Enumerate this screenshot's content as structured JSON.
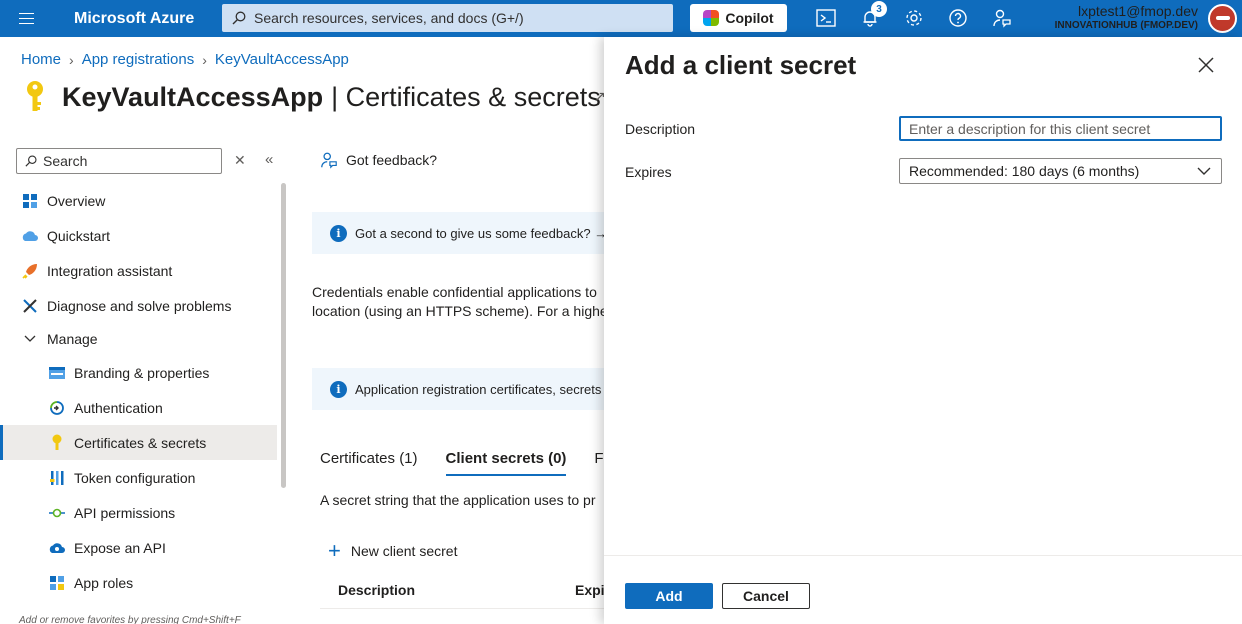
{
  "topbar": {
    "brand": "Microsoft Azure",
    "search_placeholder": "Search resources, services, and docs (G+/)",
    "copilot_label": "Copilot",
    "notification_count": "3",
    "account_email": "lxptest1@fmop.dev",
    "account_tenant": "INNOVATIONHUB (FMOP.DEV)",
    "icons": [
      "hamburger-icon",
      "search-icon",
      "cloud-shell-icon",
      "notifications-icon",
      "settings-icon",
      "help-icon",
      "feedback-icon"
    ]
  },
  "breadcrumb": {
    "items": [
      "Home",
      "App registrations",
      "KeyVaultAccessApp"
    ]
  },
  "page": {
    "app_name": "KeyVaultAccessApp",
    "section_title": "| Certificates & secrets"
  },
  "nav": {
    "search_placeholder": "Search",
    "items": [
      {
        "label": "Overview",
        "icon": "overview-icon"
      },
      {
        "label": "Quickstart",
        "icon": "quickstart-icon"
      },
      {
        "label": "Integration assistant",
        "icon": "rocket-icon"
      },
      {
        "label": "Diagnose and solve problems",
        "icon": "wrench-icon"
      },
      {
        "label": "Manage",
        "icon": "chevron-down-icon"
      },
      {
        "label": "Branding & properties",
        "icon": "branding-icon"
      },
      {
        "label": "Authentication",
        "icon": "authentication-icon"
      },
      {
        "label": "Certificates & secrets",
        "icon": "key-icon",
        "selected": true
      },
      {
        "label": "Token configuration",
        "icon": "token-icon"
      },
      {
        "label": "API permissions",
        "icon": "api-permissions-icon"
      },
      {
        "label": "Expose an API",
        "icon": "cloud-icon"
      },
      {
        "label": "App roles",
        "icon": "app-roles-icon"
      }
    ],
    "favorites_hint": "Add or remove favorites by pressing Cmd+Shift+F"
  },
  "content": {
    "feedback_label": "Got feedback?",
    "banner1": "Got a second to give us some feedback? →",
    "body_line1": "Credentials enable confidential applications to",
    "body_line2": "location (using an HTTPS scheme). For a higher",
    "banner2": "Application registration certificates, secrets",
    "tabs": [
      "Certificates (1)",
      "Client secrets (0)",
      "Fe"
    ],
    "secret_description": "A secret string that the application uses to pr",
    "new_secret_label": "New client secret",
    "columns": [
      "Description",
      "Expi"
    ]
  },
  "panel": {
    "title": "Add a client secret",
    "description_label": "Description",
    "description_placeholder": "Enter a description for this client secret",
    "expires_label": "Expires",
    "expires_value": "Recommended: 180 days (6 months)",
    "add_label": "Add",
    "cancel_label": "Cancel"
  },
  "colors": {
    "topbar": "#0f6cbd",
    "accent": "#0f6cbd",
    "selected_nav": "#edebe9",
    "banner": "#eff6fc"
  }
}
